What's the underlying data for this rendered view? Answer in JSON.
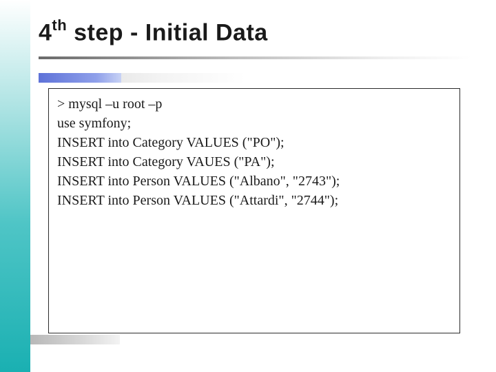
{
  "title": {
    "number": "4",
    "ordinal": "th",
    "rest": " step - Initial Data"
  },
  "code": {
    "lines": [
      "> mysql –u root –p",
      "use symfony;",
      "INSERT into Category VALUES (\"PO\");",
      "INSERT into Category VAUES (\"PA\");",
      "INSERT into Person VALUES (\"Albano\", \"2743\");",
      "INSERT into Person VALUES (\"Attardi\", \"2744\");"
    ]
  }
}
